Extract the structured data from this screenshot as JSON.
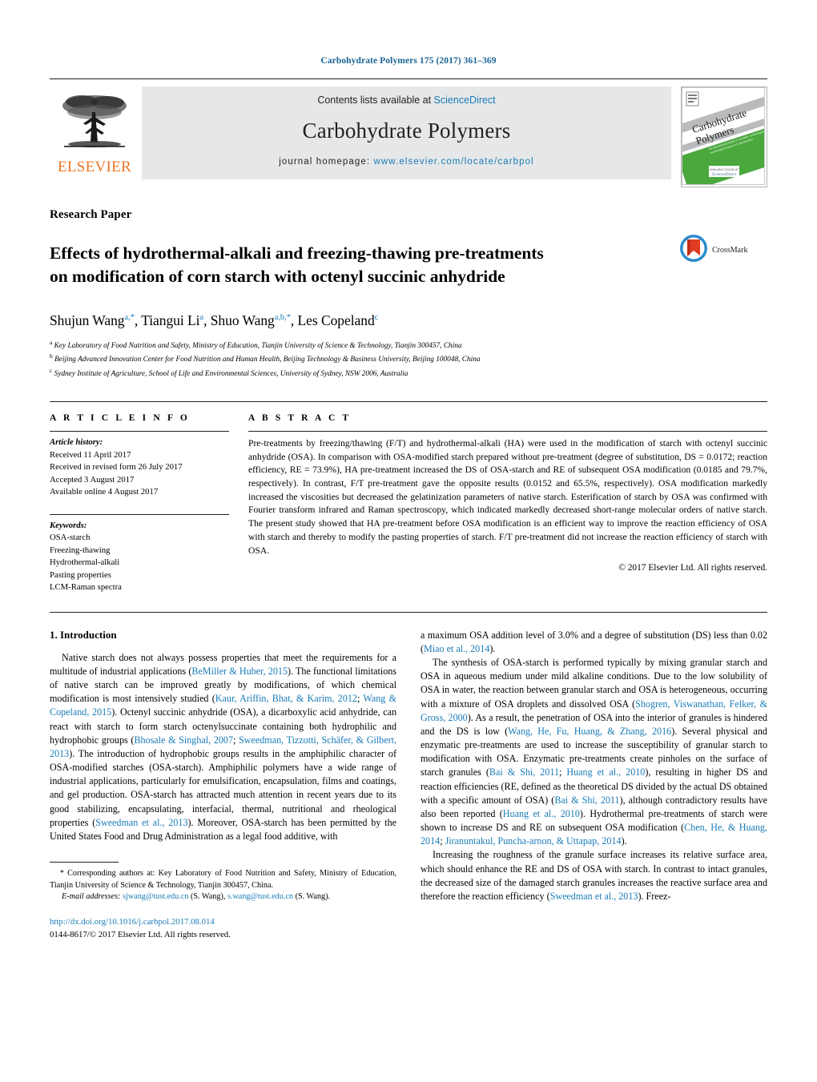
{
  "running_head": "Carbohydrate Polymers 175 (2017) 361–369",
  "masthead": {
    "publisher": "ELSEVIER",
    "contents_prefix": "Contents lists available at ",
    "contents_link": "ScienceDirect",
    "journal_title": "Carbohydrate Polymers",
    "homepage_prefix": "journal homepage:",
    "homepage_url": "www.elsevier.com/locate/carbpol",
    "cover_title_line1": "Carbohydrate",
    "cover_title_line2": "Polymers",
    "cover_sub": "An international journal of scientific, technological and biological aspects of carbohydrates",
    "cover_footer": "ScienceDirect",
    "accent_link_color": "#1a7cb8",
    "elsevier_orange": "#ec7623"
  },
  "article": {
    "type": "Research Paper",
    "title_line1": "Effects of hydrothermal-alkali and freezing-thawing pre-treatments",
    "title_line2": "on modification of corn starch with octenyl succinic anhydride",
    "crossmark_label": "CrossMark",
    "authors_html": "Shujun Wang<sup>a,</sup><sup>*</sup>, Tiangui Li<sup>a</sup>, Shuo Wang<sup>a,</sup><sup>b,</sup><sup>*</sup>, Les Copeland<sup>c</sup>",
    "affiliations": [
      {
        "marker": "a",
        "text": "Key Laboratory of Food Nutrition and Safety, Ministry of Education, Tianjin University of Science & Technology, Tianjin 300457, China"
      },
      {
        "marker": "b",
        "text": "Beijing Advanced Innovation Center for Food Nutrition and Human Health, Beijing Technology & Business University, Beijing 100048, China"
      },
      {
        "marker": "c",
        "text": "Sydney Institute of Agriculture, School of Life and Environmental Sciences, University of Sydney, NSW 2006, Australia"
      }
    ]
  },
  "article_info": {
    "heading": "A R T I C L E   I N F O",
    "history_label": "Article history:",
    "history": [
      "Received 11 April 2017",
      "Received in revised form 26 July 2017",
      "Accepted 3 August 2017",
      "Available online 4 August 2017"
    ],
    "keywords_label": "Keywords:",
    "keywords": [
      "OSA-starch",
      "Freezing-thawing",
      "Hydrothermal-alkali",
      "Pasting properties",
      "LCM-Raman spectra"
    ]
  },
  "abstract": {
    "heading": "A B S T R A C T",
    "text": "Pre-treatments by freezing/thawing (F/T) and hydrothermal-alkali (HA) were used in the modification of starch with octenyl succinic anhydride (OSA). In comparison with OSA-modified starch prepared without pre-treatment (degree of substitution, DS = 0.0172; reaction efficiency, RE = 73.9%), HA pre-treatment increased the DS of OSA-starch and RE of subsequent OSA modification (0.0185 and 79.7%, respectively). In contrast, F/T pre-treatment gave the opposite results (0.0152 and 65.5%, respectively). OSA modification markedly increased the viscosities but decreased the gelatinization parameters of native starch. Esterification of starch by OSA was confirmed with Fourier transform infrared and Raman spectroscopy, which indicated markedly decreased short-range molecular orders of native starch. The present study showed that HA pre-treatment before OSA modification is an efficient way to improve the reaction efficiency of OSA with starch and thereby to modify the pasting properties of starch. F/T pre-treatment did not increase the reaction efficiency of starch with OSA.",
    "copyright": "© 2017 Elsevier Ltd. All rights reserved."
  },
  "introduction": {
    "heading": "1. Introduction",
    "left_paragraphs": [
      "Native starch does not always possess properties that meet the requirements for a multitude of industrial applications (<span class=\"ref\">BeMiller & Huber, 2015</span>). The functional limitations of native starch can be improved greatly by modifications, of which chemical modification is most intensively studied (<span class=\"ref\">Kaur, Ariffin, Bhat, & Karim, 2012</span>; <span class=\"ref\">Wang & Copeland, 2015</span>). Octenyl succinic anhydride (OSA), a dicarboxylic acid anhydride, can react with starch to form starch octenylsuccinate containing both hydrophilic and hydrophobic groups (<span class=\"ref\">Bhosale & Singhal, 2007</span>; <span class=\"ref\">Sweedman, Tizzotti, Schäfer, & Gilbert, 2013</span>). The introduction of hydrophobic groups results in the amphiphilic character of OSA-modified starches (OSA-starch). Amphiphilic polymers have a wide range of industrial applications, particularly for emulsification, encapsulation, films and coatings, and gel production. OSA-starch has attracted much attention in recent years due to its good stabilizing, encapsulating, interfacial, thermal, nutritional and rheological properties (<span class=\"ref\">Sweedman et al., 2013</span>). Moreover, OSA-starch has been permitted by the United States Food and Drug Administration as a legal food additive, with"
    ],
    "right_paragraphs": [
      "a maximum OSA addition level of 3.0% and a degree of substitution (DS) less than 0.02 (<span class=\"ref\">Miao et al., 2014</span>).",
      "The synthesis of OSA-starch is performed typically by mixing granular starch and OSA in aqueous medium under mild alkaline conditions. Due to the low solubility of OSA in water, the reaction between granular starch and OSA is heterogeneous, occurring with a mixture of OSA droplets and dissolved OSA (<span class=\"ref\">Shogren, Viswanathan, Felker, & Gross, 2000</span>). As a result, the penetration of OSA into the interior of granules is hindered and the DS is low (<span class=\"ref\">Wang, He, Fu, Huang, & Zhang, 2016</span>). Several physical and enzymatic pre-treatments are used to increase the susceptibility of granular starch to modification with OSA. Enzymatic pre-treatments create pinholes on the surface of starch granules (<span class=\"ref\">Bai & Shi, 2011</span>; <span class=\"ref\">Huang et al., 2010</span>), resulting in higher DS and reaction efficiencies (RE, defined as the theoretical DS divided by the actual DS obtained with a specific amount of OSA) (<span class=\"ref\">Bai & Shi, 2011</span>), although contradictory results have also been reported (<span class=\"ref\">Huang et al., 2010</span>). Hydrothermal pre-treatments of starch were shown to increase DS and RE on subsequent OSA modification (<span class=\"ref\">Chen, He, & Huang, 2014</span>; <span class=\"ref\">Jiranuntakul, Puncha-arnon, & Uttapap, 2014</span>).",
      "Increasing the roughness of the granule surface increases its relative surface area, which should enhance the RE and DS of OSA with starch. In contrast to intact granules, the decreased size of the damaged starch granules increases the reactive surface area and therefore the reaction efficiency (<span class=\"ref\">Sweedman et al., 2013</span>). Freez-"
    ]
  },
  "footer": {
    "corresponding_html": "<span class=\"fn-ind\">&nbsp;&nbsp;&nbsp;</span>* Corresponding authors at: Key Laboratory of Food Nutrition and Safety, Ministry of Education, Tianjin University of Science & Technology, Tianjin 300457, China.",
    "email_label": "E-mail addresses:",
    "email1": "sjwang@tust.edu.cn",
    "email1_owner": "(S. Wang),",
    "email2": "s.wang@tust.edu.cn",
    "email2_owner": "(S. Wang).",
    "doi": "http://dx.doi.org/10.1016/j.carbpol.2017.08.014",
    "issn_line": "0144-8617/© 2017 Elsevier Ltd. All rights reserved."
  }
}
